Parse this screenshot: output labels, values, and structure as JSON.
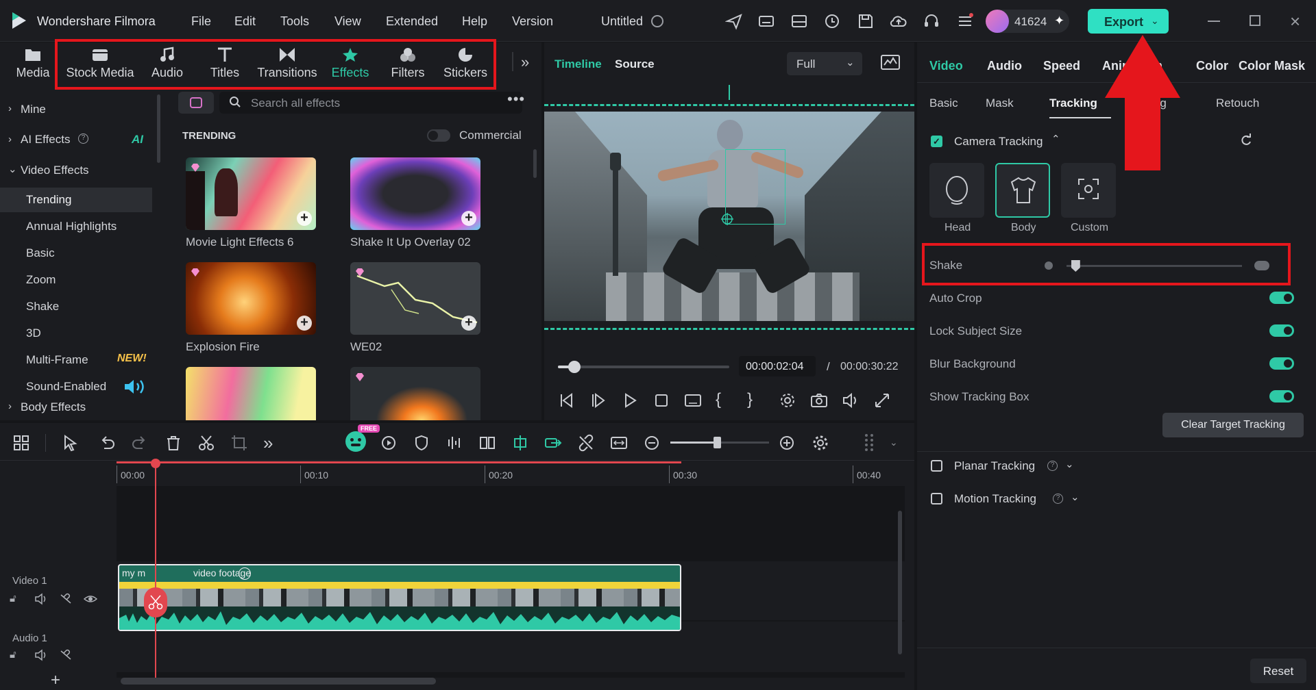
{
  "app": {
    "name": "Wondershare Filmora",
    "project_title": "Untitled",
    "user_id": "41624",
    "export_label": "Export"
  },
  "menu": [
    "File",
    "Edit",
    "Tools",
    "View",
    "Extended",
    "Help",
    "Version"
  ],
  "media_tabs": [
    {
      "label": "Media",
      "icon": "media-folder-icon"
    },
    {
      "label": "Stock Media",
      "icon": "stock-media-icon"
    },
    {
      "label": "Audio",
      "icon": "music-note-icon"
    },
    {
      "label": "Titles",
      "icon": "titles-icon"
    },
    {
      "label": "Transitions",
      "icon": "transitions-icon"
    },
    {
      "label": "Effects",
      "icon": "effects-icon"
    },
    {
      "label": "Filters",
      "icon": "filters-icon"
    },
    {
      "label": "Stickers",
      "icon": "stickers-icon"
    }
  ],
  "sidebar": {
    "mine": "Mine",
    "ai_effects": "AI Effects",
    "ai_badge": "AI",
    "video_effects": "Video Effects",
    "items": [
      "Trending",
      "Annual Highlights",
      "Basic",
      "Zoom",
      "Shake",
      "3D",
      "Multi-Frame",
      "Sound-Enabled"
    ],
    "new_badge": "NEW!",
    "body_effects": "Body Effects"
  },
  "effects": {
    "search_placeholder": "Search all effects",
    "section": "TRENDING",
    "commercial": "Commercial",
    "items": [
      "Movie Light Effects 6",
      "Shake It Up Overlay 02",
      "Explosion Fire",
      "WE02"
    ]
  },
  "player": {
    "tab_timeline": "Timeline",
    "tab_source": "Source",
    "quality": "Full",
    "current_time": "00:00:02:04",
    "separator": "/",
    "total_time": "00:00:30:22"
  },
  "right_panel": {
    "tabs": [
      "Video",
      "Audio",
      "Speed",
      "Animation",
      "Color",
      "Color Mask"
    ],
    "subtabs": [
      "Basic",
      "Mask",
      "Tracking",
      "Cutting",
      "Retouch"
    ],
    "camera_tracking": "Camera Tracking",
    "modes": [
      "Head",
      "Body",
      "Custom"
    ],
    "shake": "Shake",
    "shake_level": 0.05,
    "options": [
      "Auto Crop",
      "Lock Subject Size",
      "Blur Background",
      "Show Tracking Box"
    ],
    "clear_button": "Clear Target Tracking",
    "planar": "Planar Tracking",
    "motion": "Motion Tracking",
    "reset": "Reset"
  },
  "timeline": {
    "ruler": [
      "00:00",
      "00:10",
      "00:20",
      "00:30",
      "00:40"
    ],
    "video_track": "Video 1",
    "audio_track": "Audio 1",
    "clip_name_a": "my m",
    "clip_name_b": "video footage",
    "free_badge": "FREE"
  },
  "colors": {
    "accent": "#2fc9a6",
    "playhead": "#e2474f",
    "annotation": "#e5161c",
    "export_bg": "#2fe0c3"
  }
}
